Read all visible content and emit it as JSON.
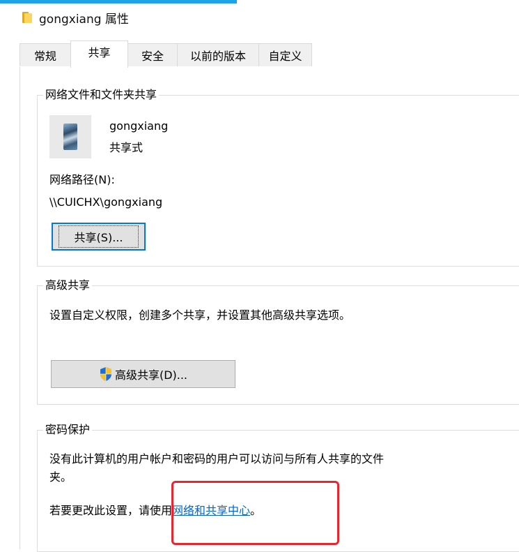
{
  "window": {
    "title": "gongxiang 属性"
  },
  "tabs": [
    {
      "label": "常规"
    },
    {
      "label": "共享"
    },
    {
      "label": "安全"
    },
    {
      "label": "以前的版本"
    },
    {
      "label": "自定义"
    }
  ],
  "network_share": {
    "group_label": "网络文件和文件夹共享",
    "folder_name": "gongxiang",
    "status": "共享式",
    "path_label": "网络路径(N):",
    "path_value": "\\\\CUICHX\\gongxiang",
    "share_button": "共享(S)..."
  },
  "advanced_share": {
    "group_label": "高级共享",
    "description": "设置自定义权限，创建多个共享，并设置其他高级共享选项。",
    "button": "高级共享(D)..."
  },
  "password_protection": {
    "group_label": "密码保护",
    "description_line1": "没有此计算机的用户帐户和密码的用户可以访问与所有人共享的文件",
    "description_line2": "夹。",
    "change_prefix": "若要更改此设置，请使用",
    "link_text": "网络和共享中心",
    "change_suffix": "。"
  },
  "colors": {
    "accent": "#1aa3e8",
    "link": "#0066cc",
    "annotation_box": "#e8262f"
  }
}
